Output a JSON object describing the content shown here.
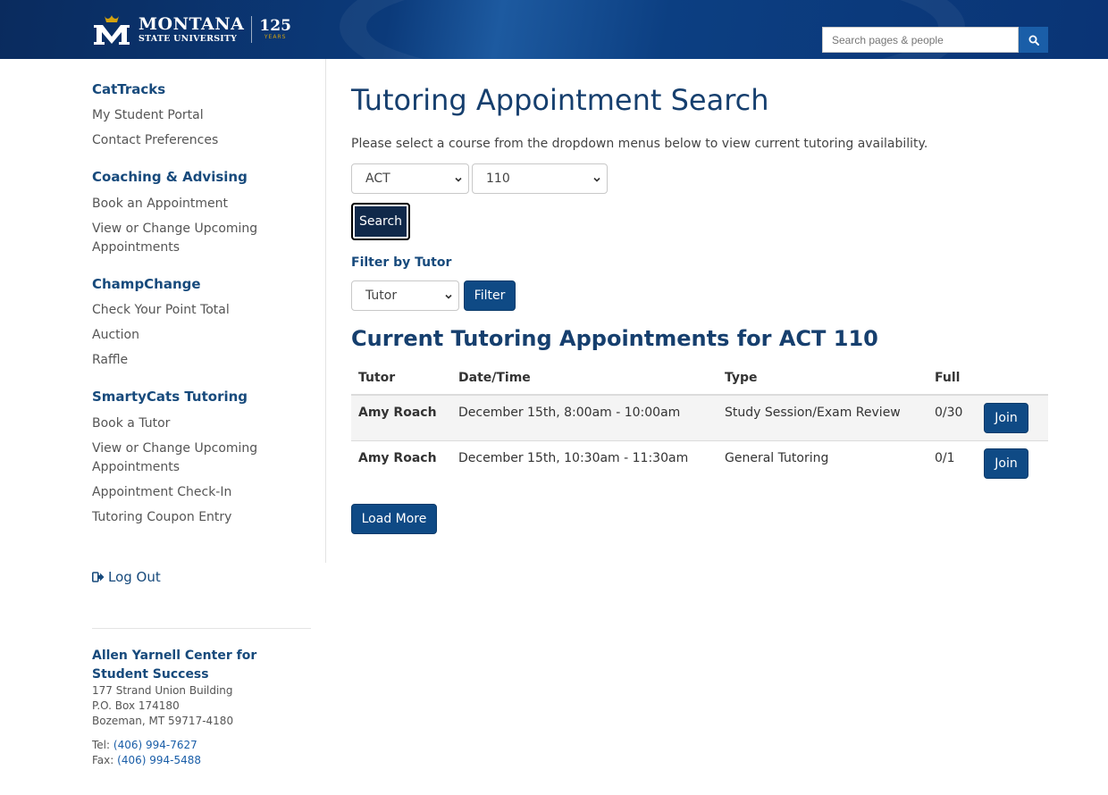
{
  "header": {
    "logo_line1": "MONTANA",
    "logo_line2": "STATE UNIVERSITY",
    "logo_anniv": "125",
    "logo_anniv_sub": "YEARS",
    "search_placeholder": "Search pages & people",
    "search_icon": "search-icon"
  },
  "sidebar": {
    "sections": [
      {
        "heading": "CatTracks",
        "links": [
          "My Student Portal",
          "Contact Preferences"
        ]
      },
      {
        "heading": "Coaching & Advising",
        "links": [
          "Book an Appointment",
          "View or Change Upcoming Appointments"
        ]
      },
      {
        "heading": "ChampChange",
        "links": [
          "Check Your Point Total",
          "Auction",
          "Raffle"
        ]
      },
      {
        "heading": "SmartyCats Tutoring",
        "links": [
          "Book a Tutor",
          "View or Change Upcoming Appointments",
          "Appointment Check-In",
          "Tutoring Coupon Entry"
        ]
      }
    ],
    "logout_label": "Log Out",
    "address": {
      "name": "Allen Yarnell Center for Student Success",
      "line1": "177 Strand Union Building",
      "line2": "P.O. Box 174180",
      "line3": "Bozeman, MT 59717-4180",
      "tel_label": "Tel:",
      "tel": "(406) 994-7627",
      "fax_label": "Fax:",
      "fax": "(406) 994-5488"
    }
  },
  "main": {
    "title": "Tutoring Appointment Search",
    "intro": "Please select a course from the dropdown menus below to view current tutoring availability.",
    "subject_select": "ACT",
    "course_select": "110",
    "search_label": "Search",
    "filter_label": "Filter by Tutor",
    "tutor_select": "Tutor",
    "filter_button": "Filter",
    "results_title": "Current Tutoring Appointments for ACT 110",
    "table": {
      "headers": [
        "Tutor",
        "Date/Time",
        "Type",
        "Full"
      ],
      "rows": [
        {
          "tutor": "Amy Roach",
          "datetime": "December 15th, 8:00am - 10:00am",
          "type": "Study Session/Exam Review",
          "full": "0/30",
          "action": "Join"
        },
        {
          "tutor": "Amy Roach",
          "datetime": "December 15th, 10:30am - 11:30am",
          "type": "General Tutoring",
          "full": "0/1",
          "action": "Join"
        }
      ]
    },
    "load_more": "Load More"
  },
  "colors": {
    "header_navy": "#0a2b5e",
    "link_blue": "#174a7c",
    "button_blue": "#0f4a85",
    "gold": "#d4a20e"
  }
}
